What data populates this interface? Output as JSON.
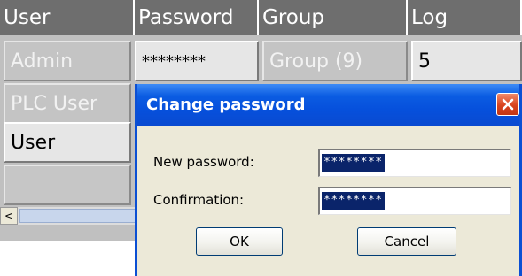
{
  "table": {
    "headers": [
      "User",
      "Password",
      "Group",
      "Log"
    ],
    "rows": [
      {
        "user": "Admin",
        "password": "********",
        "group": "Group (9)",
        "log": "5"
      },
      {
        "user": "PLC User"
      },
      {
        "user": "User"
      },
      {
        "user": ""
      }
    ],
    "scroll_left_glyph": "<"
  },
  "dialog": {
    "title": "Change password",
    "new_password_label": "New password:",
    "new_password_value": "********",
    "confirmation_label": "Confirmation:",
    "confirmation_value": "********",
    "ok_label": "OK",
    "cancel_label": "Cancel"
  },
  "icons": {
    "close": "close-icon",
    "scroll_left": "chevron-left-icon"
  },
  "colors": {
    "title_bar": "#0650dc",
    "close_button": "#d9441f",
    "header": "#6e6e6e",
    "selection": "#0a246a"
  }
}
